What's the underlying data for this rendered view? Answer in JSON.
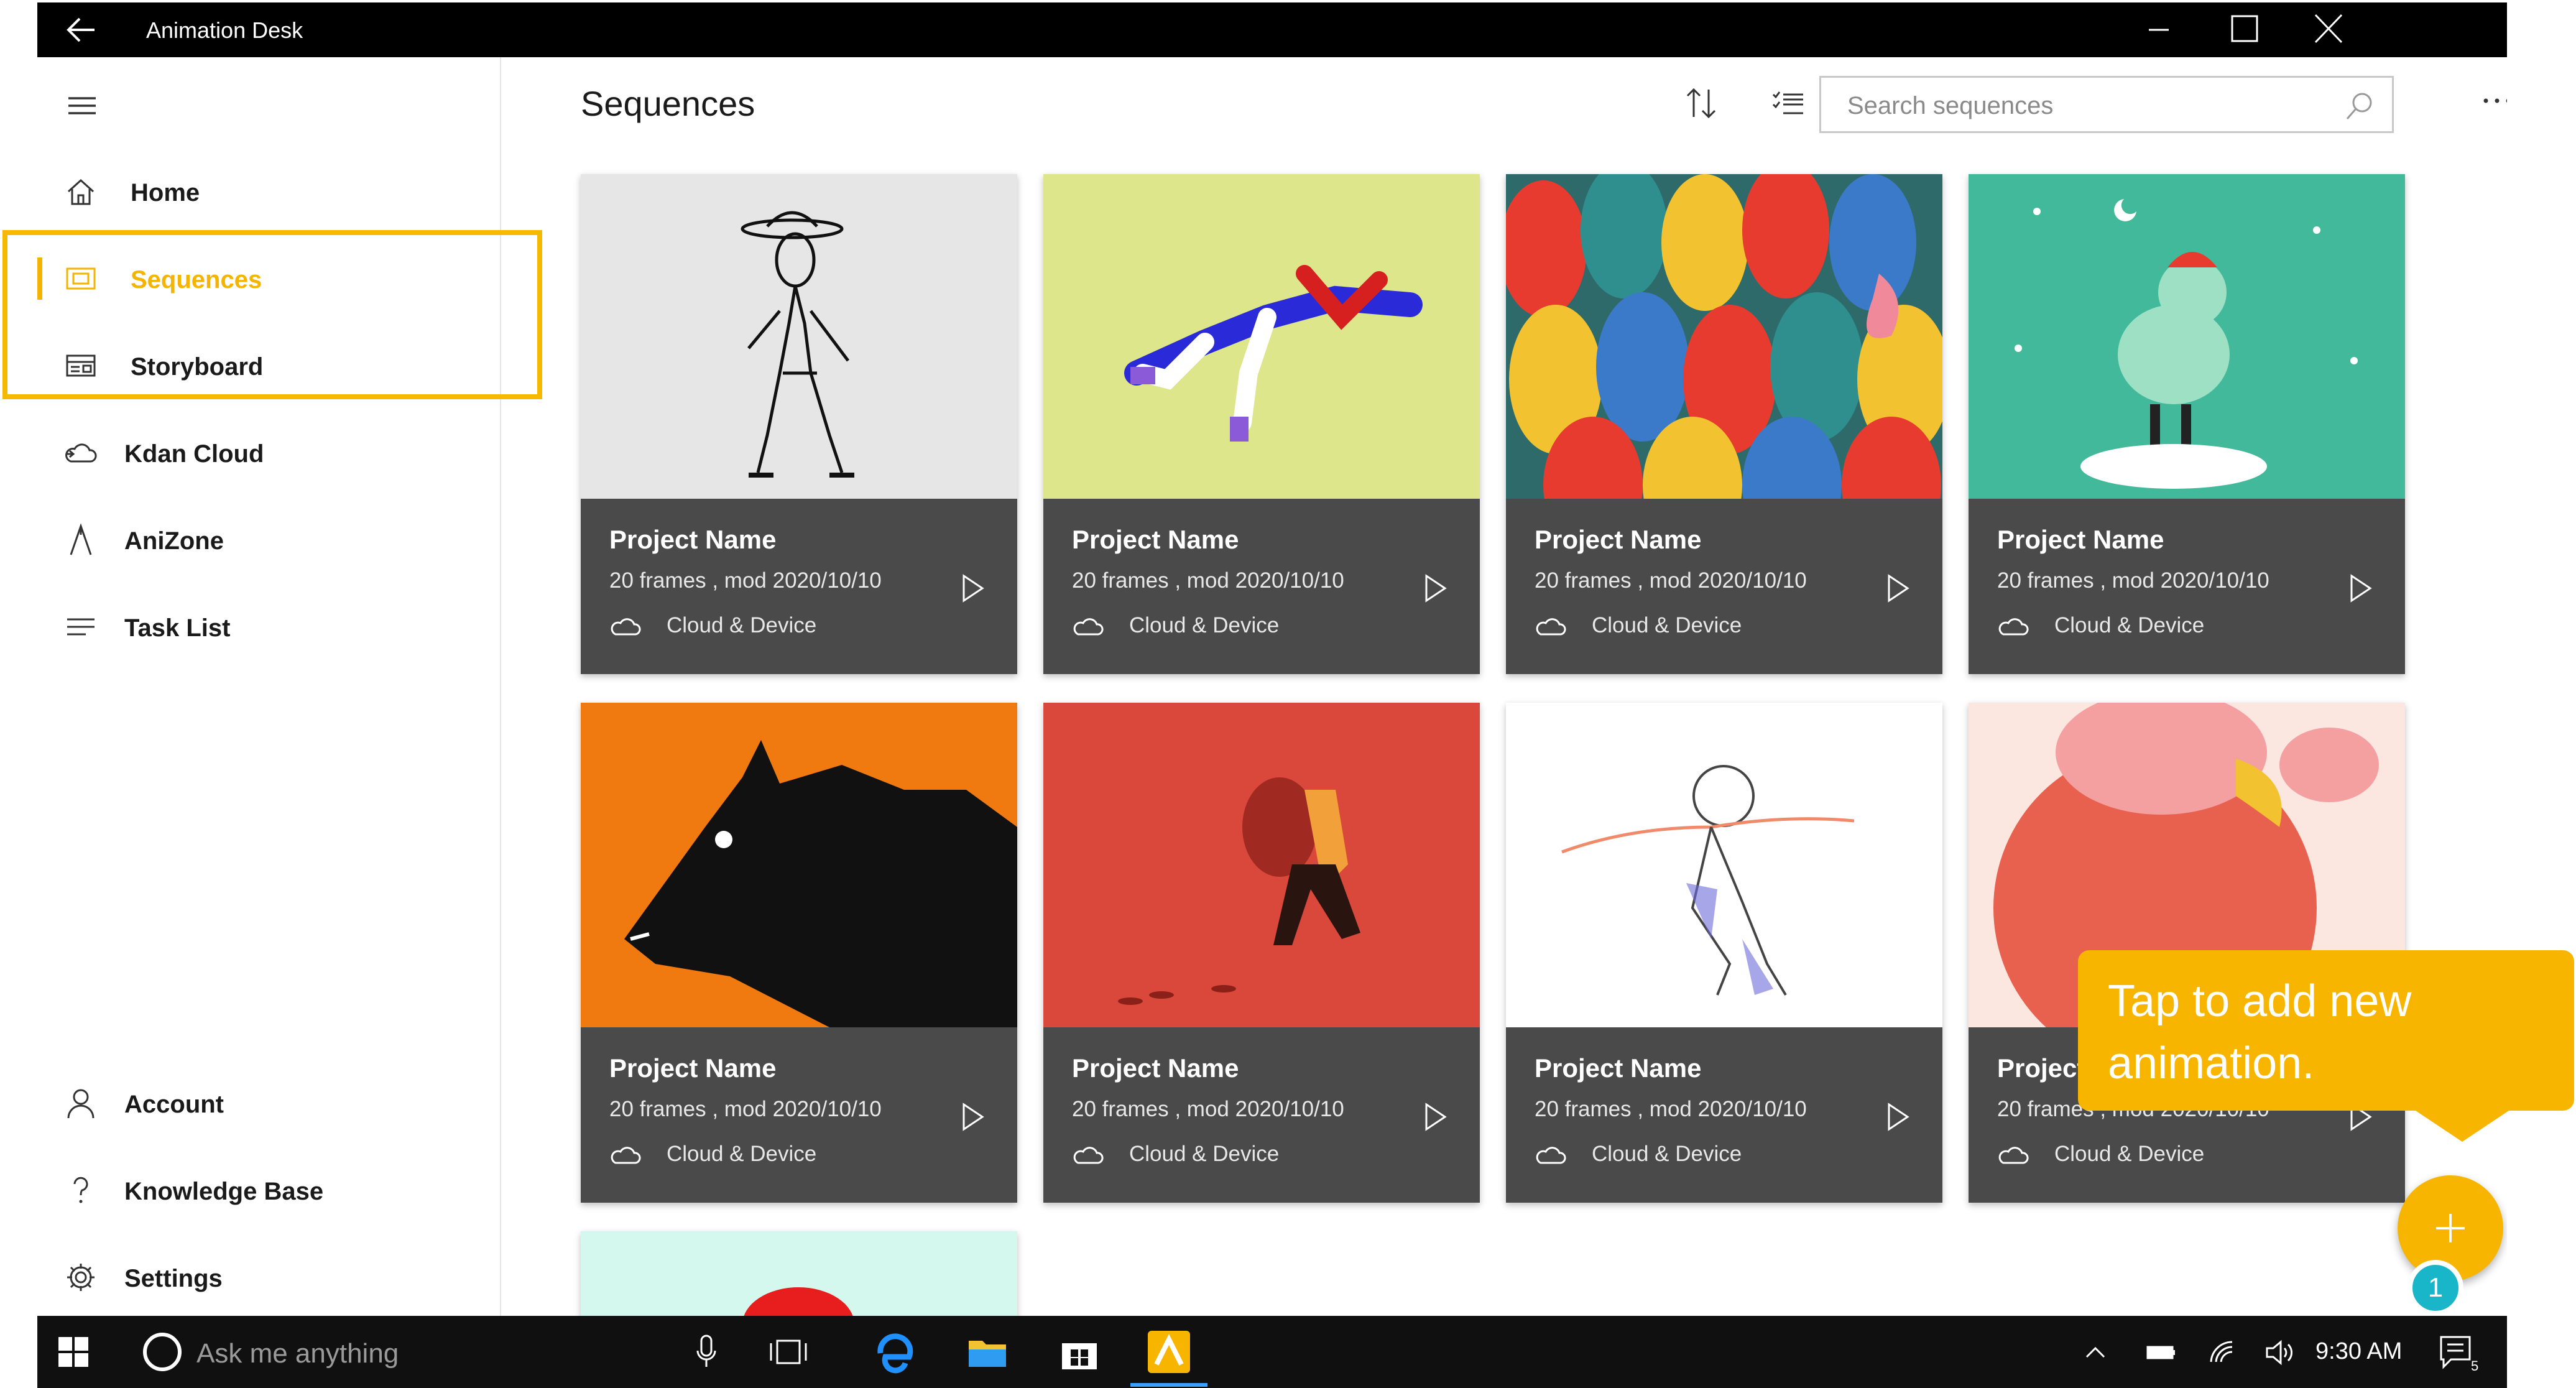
{
  "window": {
    "title": "Animation Desk"
  },
  "sidebar": {
    "items": [
      {
        "label": "Home",
        "icon": "home-icon"
      },
      {
        "label": "Sequences",
        "icon": "sequences-icon",
        "active": true
      },
      {
        "label": "Storyboard",
        "icon": "storyboard-icon"
      },
      {
        "label": "Kdan Cloud",
        "icon": "cloud-icon"
      },
      {
        "label": "AniZone",
        "icon": "anizone-icon"
      },
      {
        "label": "Task List",
        "icon": "task-list-icon"
      }
    ],
    "bottom_items": [
      {
        "label": "Account",
        "icon": "account-icon"
      },
      {
        "label": "Knowledge Base",
        "icon": "help-icon"
      },
      {
        "label": "Settings",
        "icon": "gear-icon"
      }
    ]
  },
  "header": {
    "title": "Sequences",
    "search_placeholder": "Search sequences"
  },
  "cards": [
    {
      "name": "Project Name",
      "meta": "20 frames , mod 2020/10/10",
      "location": "Cloud & Device"
    },
    {
      "name": "Project Name",
      "meta": "20 frames , mod 2020/10/10",
      "location": "Cloud & Device"
    },
    {
      "name": "Project Name",
      "meta": "20 frames , mod 2020/10/10",
      "location": "Cloud & Device"
    },
    {
      "name": "Project Name",
      "meta": "20 frames , mod 2020/10/10",
      "location": "Cloud & Device"
    },
    {
      "name": "Project Name",
      "meta": "20 frames , mod 2020/10/10",
      "location": "Cloud & Device"
    },
    {
      "name": "Project Name",
      "meta": "20 frames , mod 2020/10/10",
      "location": "Cloud & Device"
    },
    {
      "name": "Project Name",
      "meta": "20 frames , mod 2020/10/10",
      "location": "Cloud & Device"
    },
    {
      "name": "Project Name",
      "meta": "20 frames , mod 2020/10/10",
      "location": "Cloud & Device"
    }
  ],
  "tooltip": {
    "text": "Tap to add new animation."
  },
  "fab": {
    "badge": "1"
  },
  "taskbar": {
    "search_placeholder": "Ask me anything",
    "time": "9:30 AM",
    "notifications": "5"
  },
  "colors": {
    "accent": "#f7b500",
    "card_info": "#4a4a4a",
    "badge": "#19b6c9"
  }
}
